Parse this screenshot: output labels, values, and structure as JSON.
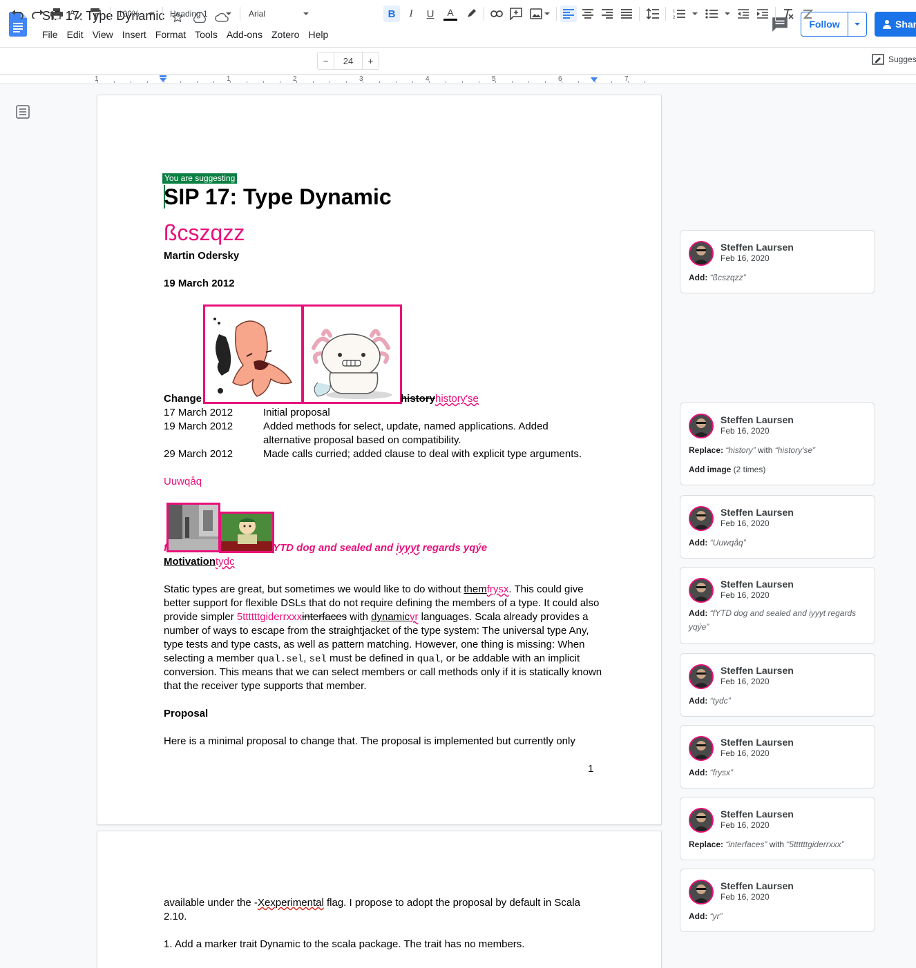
{
  "app": {
    "doc_title": "SIP 17: Type Dynamic",
    "menu": [
      "File",
      "Edit",
      "View",
      "Insert",
      "Format",
      "Tools",
      "Add-ons",
      "Zotero",
      "Help"
    ],
    "follow_label": "Follow",
    "share_label": "Shar",
    "suggesting_label": "Sugges"
  },
  "toolbar": {
    "zoom": "100%",
    "style": "Heading 1",
    "font": "Arial",
    "font_size": "24"
  },
  "ruler": {
    "labels": [
      "1",
      "1",
      "2",
      "3",
      "4",
      "5",
      "6",
      "7"
    ]
  },
  "doc": {
    "suggesting_badge": "You are suggesting",
    "title": "SIP 17: Type Dynamic",
    "inserted_title": "ßcszqzz",
    "author": "Martin Odersky",
    "date": "19 March 2012",
    "change_label": "Change",
    "history_old": "history",
    "history_new": "history'se",
    "history_rows": [
      {
        "date": "17 March 2012",
        "text": "Initial proposal"
      },
      {
        "date": "19 March 2012",
        "text": "Added methods for select, update, named applications. Added",
        "text2": "alternative proposal based on compatibility."
      },
      {
        "date": "29 March 2012",
        "text": "Made calls curried; added clause to deal with explicit type arguments."
      }
    ],
    "inserted_line": "Uuwqåq",
    "caption_lead": "f",
    "caption_a": "YTD dog and sealed and ",
    "caption_b": "iyyyt",
    "caption_c": " regards yqýe",
    "motivation_heading": "Motivation",
    "motivation_insert": "tydc",
    "para1": {
      "l1a": "Static types are great, but sometimes we would like to do without ",
      "l1b": "them",
      "l1c": "frysx",
      "l1d": ". This could give",
      "l2": "better support for flexible DSLs that do not require defining the members of a type. It could also",
      "l3a": "provide simpler ",
      "l3b": "5ttttttgiderrxxx",
      "l3c": "interfaces",
      "l3d": " with ",
      "l3e": "dynamic",
      "l3f": "yr",
      "l3g": " languages. Scala already provides a",
      "l4": "number of ways to escape from the straightjacket of the type system: The universal type Any,",
      "l5": "type tests and type casts, as well as pattern matching. However, one thing is missing: When",
      "l6a": "selecting a member ",
      "l6b": "qual.sel",
      "l6c": ", ",
      "l6d": "sel",
      "l6e": " must be defined in ",
      "l6f": "qual",
      "l6g": ", or be addable with an implicit",
      "l7": "conversion. This means that we can select members or call methods only if it is statically known",
      "l8": "that the receiver type supports that member."
    },
    "proposal_heading": "Proposal",
    "proposal_line": "Here is a minimal proposal to change that. The proposal is implemented but currently only",
    "page_number": "1",
    "p2_l1a": "available under the -",
    "p2_l1b": "Xexperimental",
    "p2_l1c": " flag. I propose to adopt the proposal by default in Scala",
    "p2_l2": "2.10.",
    "p2_l3": "1. Add a marker trait Dynamic to the scala package. The trait has no members."
  },
  "comments": [
    {
      "name": "Steffen Laursen",
      "date": "Feb 16, 2020",
      "action": "Add:",
      "value": "“ßcszqzz”"
    },
    {
      "name": "Steffen Laursen",
      "date": "Feb 16, 2020",
      "action": "Replace:",
      "old": "“history”",
      "with": " with ",
      "new": "“history'se”",
      "action2": "Add image",
      "extra2": " (2 times)"
    },
    {
      "name": "Steffen Laursen",
      "date": "Feb 16, 2020",
      "action": "Add:",
      "value": "“Uuwqåq”"
    },
    {
      "name": "Steffen Laursen",
      "date": "Feb 16, 2020",
      "action": "Add:",
      "value": "“fYTD dog and sealed and iyyyt regards yqýe”"
    },
    {
      "name": "Steffen Laursen",
      "date": "Feb 16, 2020",
      "action": "Add:",
      "value": "“tydc”"
    },
    {
      "name": "Steffen Laursen",
      "date": "Feb 16, 2020",
      "action": "Add:",
      "value": "“frysx”"
    },
    {
      "name": "Steffen Laursen",
      "date": "Feb 16, 2020",
      "action": "Replace:",
      "old": "“interfaces”",
      "with": " with ",
      "new": "“5ttttttgiderrxxx”"
    },
    {
      "name": "Steffen Laursen",
      "date": "Feb 16, 2020",
      "action": "Add:",
      "value": "“yr”"
    }
  ],
  "colors": {
    "suggestion": "#e8107a",
    "accent": "#1a73e8",
    "suggest_badge": "#0b8043"
  }
}
